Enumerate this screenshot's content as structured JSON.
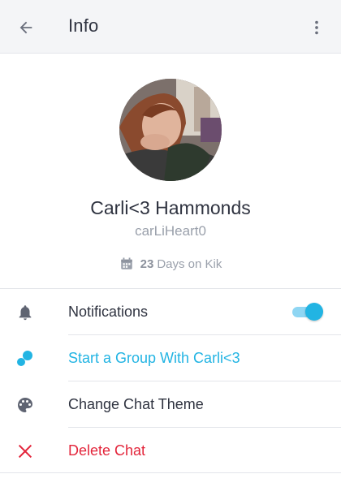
{
  "appbar": {
    "title": "Info",
    "back_icon": "arrow-left-icon",
    "more_icon": "more-vert-icon"
  },
  "profile": {
    "display_name": "Carli<3 Hammonds",
    "username": "carLiHeart0",
    "days_count": "23",
    "days_suffix": "Days on Kik",
    "calendar_icon": "calendar-icon"
  },
  "rows": {
    "notifications": {
      "label": "Notifications",
      "icon": "bell-icon",
      "toggle_on": true
    },
    "start_group": {
      "label": "Start a Group With Carli<3",
      "icon": "group-dots-icon"
    },
    "change_theme": {
      "label": "Change Chat Theme",
      "icon": "palette-icon"
    },
    "delete_chat": {
      "label": "Delete Chat",
      "icon": "close-x-icon"
    }
  },
  "colors": {
    "accent": "#22b4e3",
    "danger": "#e3253b",
    "icon_gray": "#5f6472",
    "muted_text": "#9aa0ab"
  }
}
